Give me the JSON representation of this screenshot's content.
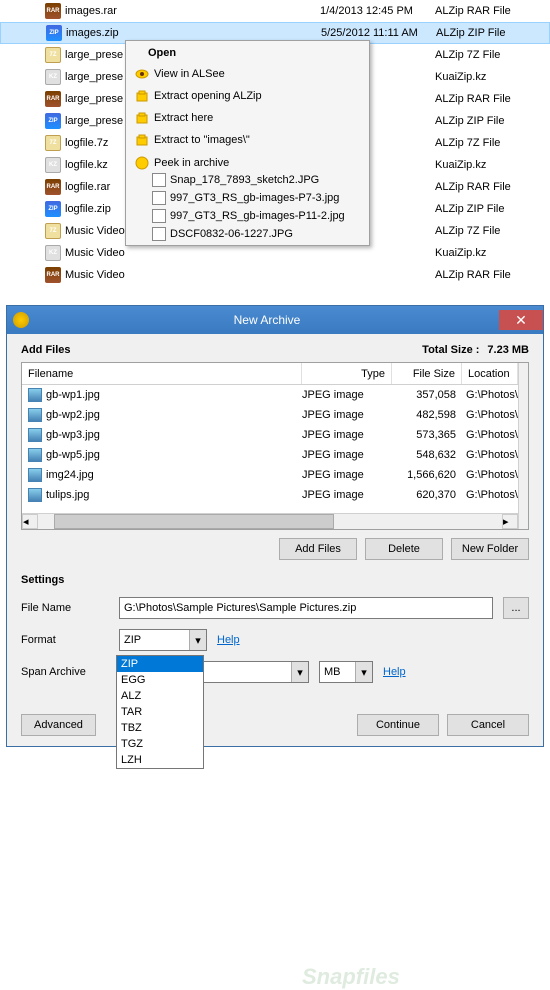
{
  "files": [
    {
      "icon": "rar",
      "name": "images.rar",
      "date": "1/4/2013 12:45 PM",
      "type": "ALZip RAR File",
      "selected": false
    },
    {
      "icon": "zip",
      "name": "images.zip",
      "date": "5/25/2012 11:11 AM",
      "type": "ALZip ZIP File",
      "selected": true
    },
    {
      "icon": "7z",
      "name": "large_prese",
      "date": "",
      "type": "ALZip 7Z File",
      "selected": false
    },
    {
      "icon": "kz",
      "name": "large_prese",
      "date": "",
      "type": "KuaiZip.kz",
      "selected": false
    },
    {
      "icon": "rar",
      "name": "large_prese",
      "date": "",
      "type": "ALZip RAR File",
      "selected": false
    },
    {
      "icon": "zip",
      "name": "large_prese",
      "date": "",
      "type": "ALZip ZIP File",
      "selected": false
    },
    {
      "icon": "7z",
      "name": "logfile.7z",
      "date": "",
      "type": "ALZip 7Z File",
      "selected": false
    },
    {
      "icon": "kz",
      "name": "logfile.kz",
      "date": "",
      "type": "KuaiZip.kz",
      "selected": false
    },
    {
      "icon": "rar",
      "name": "logfile.rar",
      "date": "",
      "type": "ALZip RAR File",
      "selected": false
    },
    {
      "icon": "zip",
      "name": "logfile.zip",
      "date": "",
      "type": "ALZip ZIP File",
      "selected": false
    },
    {
      "icon": "7z",
      "name": "Music Video",
      "date": "",
      "type": "ALZip 7Z File",
      "selected": false
    },
    {
      "icon": "kz",
      "name": "Music Video",
      "date": "",
      "type": "KuaiZip.kz",
      "selected": false
    },
    {
      "icon": "rar",
      "name": "Music Video",
      "date": "",
      "type": "ALZip RAR File",
      "selected": false
    }
  ],
  "context_menu": {
    "title": "Open",
    "items": [
      {
        "icon": "eye",
        "label": "View in ALSee"
      },
      {
        "icon": "box",
        "label": "Extract opening ALZip"
      },
      {
        "icon": "box",
        "label": "Extract here"
      },
      {
        "icon": "box",
        "label": "Extract to \"images\\\""
      }
    ],
    "peek_title": "Peek in archive",
    "peek_items": [
      "Snap_178_7893_sketch2.JPG",
      "997_GT3_RS_gb-images-P7-3.jpg",
      "997_GT3_RS_gb-images-P11-2.jpg",
      "DSCF0832-06-1227.JPG"
    ]
  },
  "dialog": {
    "title": "New Archive",
    "add_files_label": "Add Files",
    "total_size_label": "Total Size :",
    "total_size_value": "7.23 MB",
    "columns": {
      "filename": "Filename",
      "type": "Type",
      "filesize": "File Size",
      "location": "Location"
    },
    "rows": [
      {
        "name": "gb-wp1.jpg",
        "type": "JPEG image",
        "size": "357,058",
        "loc": "G:\\Photos\\"
      },
      {
        "name": "gb-wp2.jpg",
        "type": "JPEG image",
        "size": "482,598",
        "loc": "G:\\Photos\\"
      },
      {
        "name": "gb-wp3.jpg",
        "type": "JPEG image",
        "size": "573,365",
        "loc": "G:\\Photos\\"
      },
      {
        "name": "gb-wp5.jpg",
        "type": "JPEG image",
        "size": "548,632",
        "loc": "G:\\Photos\\"
      },
      {
        "name": "img24.jpg",
        "type": "JPEG image",
        "size": "1,566,620",
        "loc": "G:\\Photos\\"
      },
      {
        "name": "tulips.jpg",
        "type": "JPEG image",
        "size": "620,370",
        "loc": "G:\\Photos\\"
      }
    ],
    "buttons": {
      "add": "Add Files",
      "delete": "Delete",
      "newfolder": "New Folder"
    },
    "settings_label": "Settings",
    "filename_label": "File Name",
    "filename_value": "G:\\Photos\\Sample Pictures\\Sample Pictures.zip",
    "format_label": "Format",
    "format_value": "ZIP",
    "format_options": [
      "ZIP",
      "EGG",
      "ALZ",
      "TAR",
      "TBZ",
      "TGZ",
      "LZH"
    ],
    "help_label": "Help",
    "span_label": "Span Archive",
    "mb_label": "MB",
    "advanced_label": "Advanced",
    "continue_label": "Continue",
    "cancel_label": "Cancel",
    "browse_label": "..."
  },
  "watermark": "Snapfiles"
}
